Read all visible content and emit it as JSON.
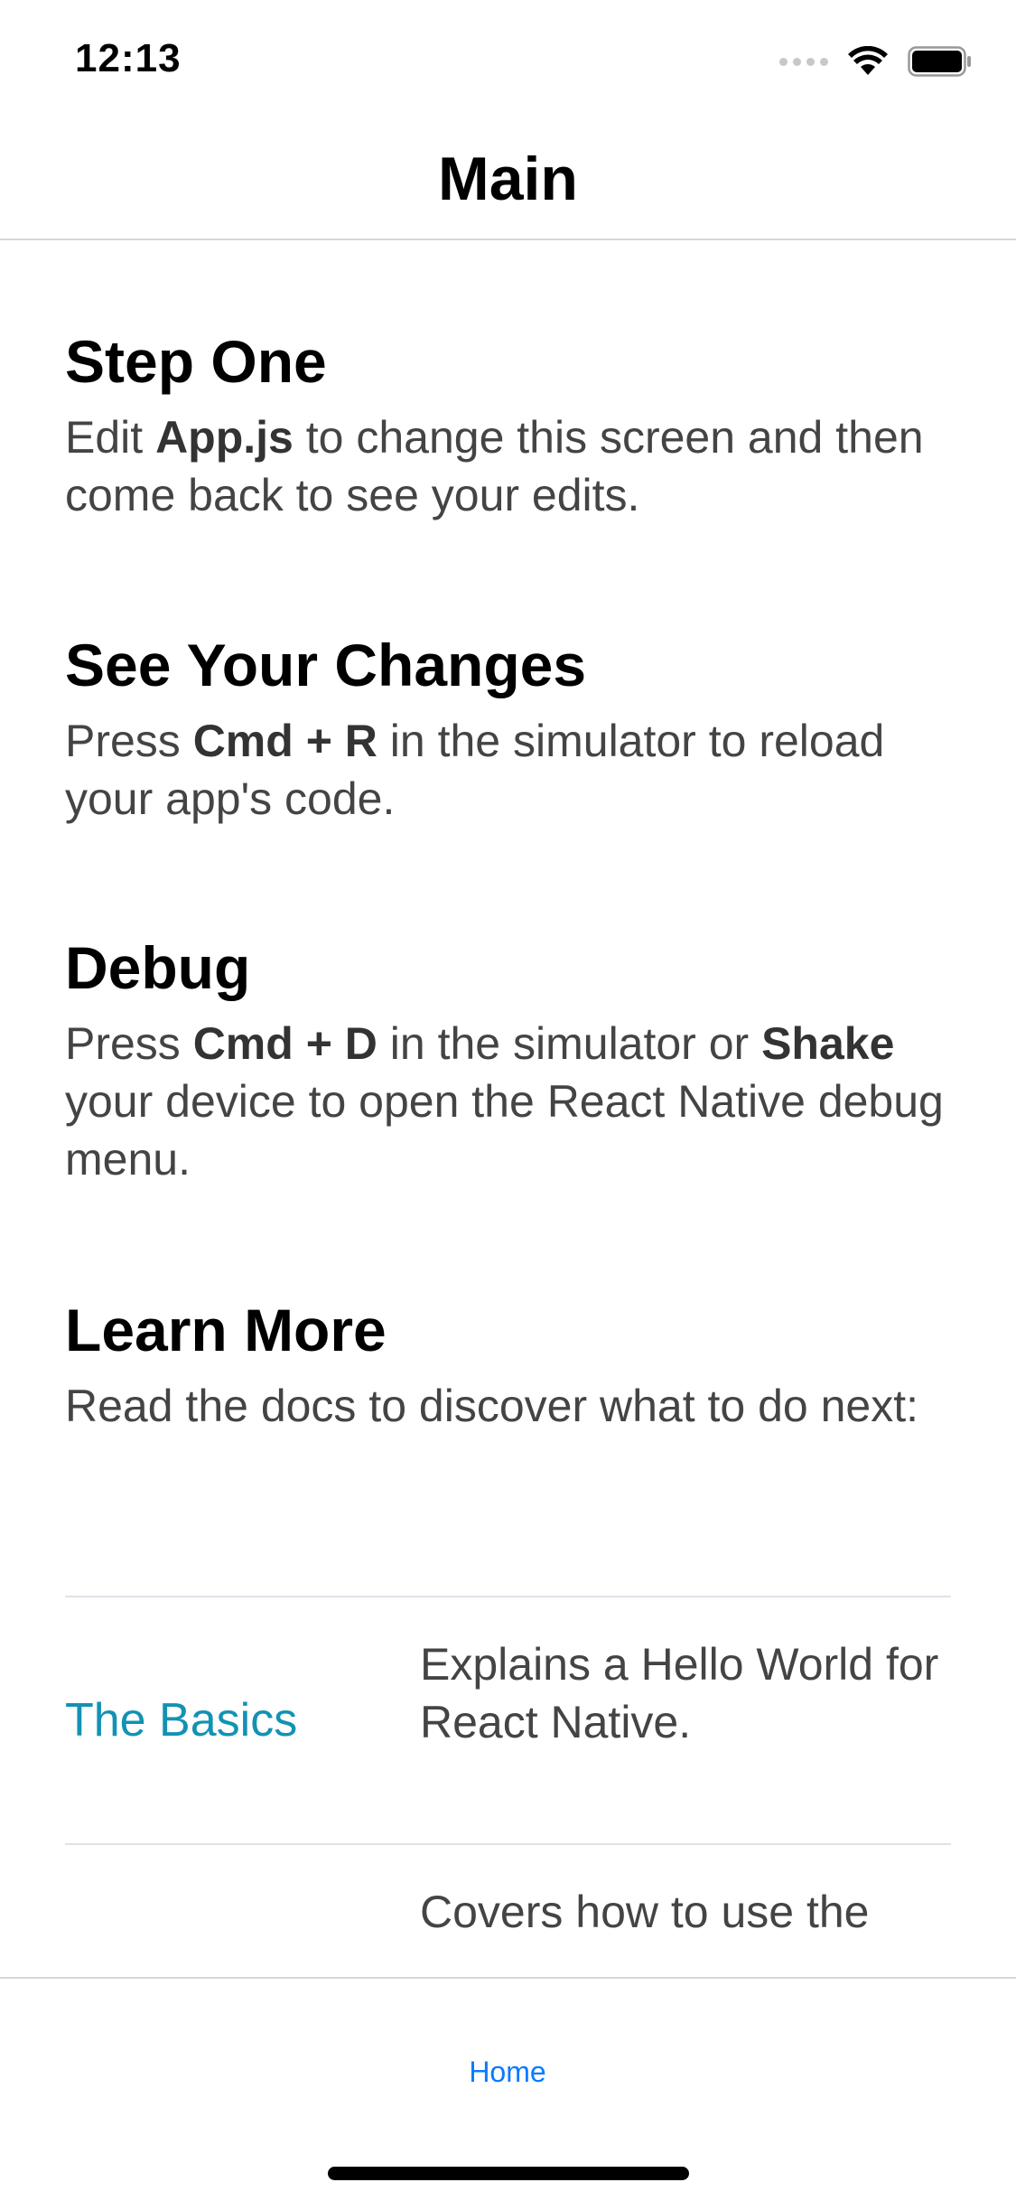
{
  "status_bar": {
    "time": "12:13"
  },
  "header": {
    "title": "Main"
  },
  "sections": [
    {
      "title": "Step One",
      "body": [
        {
          "t": "Edit "
        },
        {
          "t": "App.js",
          "b": true
        },
        {
          "t": " to change this screen and then come back to see your edits."
        }
      ]
    },
    {
      "title": "See Your Changes",
      "body": [
        {
          "t": "Press "
        },
        {
          "t": "Cmd + R",
          "b": true
        },
        {
          "t": " in the simulator to reload your app's code."
        }
      ]
    },
    {
      "title": "Debug",
      "body": [
        {
          "t": "Press "
        },
        {
          "t": "Cmd + D",
          "b": true
        },
        {
          "t": " in the simulator or "
        },
        {
          "t": "Shake",
          "b": true
        },
        {
          "t": " your device to open the React Native debug menu."
        }
      ]
    },
    {
      "title": "Learn More",
      "body": [
        {
          "t": "Read the docs to discover what to do next:"
        }
      ]
    }
  ],
  "links": [
    {
      "title": "The Basics",
      "description": "Explains a Hello World for React Native."
    },
    {
      "title": "",
      "description": "Covers how to use the"
    }
  ],
  "tab_bar": {
    "home_label": "Home",
    "accent_color": "#0a7aff"
  },
  "colors": {
    "link": "#1292b4",
    "body_text": "#444444"
  }
}
